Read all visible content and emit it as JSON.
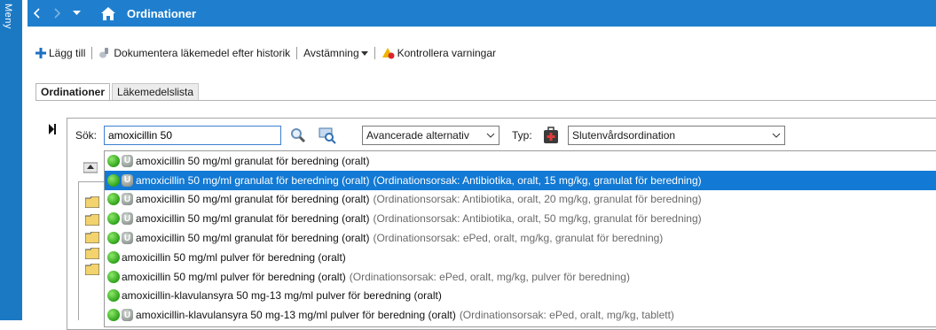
{
  "sidebar": {
    "menu_label": "Meny"
  },
  "titlebar": {
    "title": "Ordinationer",
    "icons": [
      "chevron-left-icon",
      "chevron-right-icon",
      "dropdown-triangle-icon",
      "home-icon"
    ]
  },
  "toolbar": {
    "add_label": "Lägg till",
    "document_label": "Dokumentera läkemedel efter historik",
    "reconcile_label": "Avstämning",
    "warnings_label": "Kontrollera varningar"
  },
  "tabs": [
    {
      "label": "Ordinationer",
      "active": true
    },
    {
      "label": "Läkemedelslista",
      "active": false
    }
  ],
  "search": {
    "label": "Sök:",
    "value": "amoxicillin 50",
    "advanced_value": "Avancerade alternativ",
    "type_label": "Typ:",
    "type_value": "Slutenvårdsordination"
  },
  "suggestions": [
    {
      "badge": true,
      "name": "amoxicillin 50 mg/ml granulat för beredning (oralt)",
      "reason": ""
    },
    {
      "badge": true,
      "name": "amoxicillin 50 mg/ml granulat för beredning (oralt)",
      "reason": "(Ordinationsorsak: Antibiotika, oralt, 15 mg/kg, granulat för beredning)",
      "selected": true
    },
    {
      "badge": true,
      "name": "amoxicillin 50 mg/ml granulat för beredning (oralt)",
      "reason": "(Ordinationsorsak: Antibiotika, oralt, 20 mg/kg, granulat för beredning)"
    },
    {
      "badge": true,
      "name": "amoxicillin 50 mg/ml granulat för beredning (oralt)",
      "reason": "(Ordinationsorsak: Antibiotika, oralt, 50 mg/kg, granulat för beredning)"
    },
    {
      "badge": true,
      "name": "amoxicillin 50 mg/ml granulat för beredning (oralt)",
      "reason": "(Ordinationsorsak: ePed, oralt, mg/kg, granulat för beredning)"
    },
    {
      "badge": false,
      "name": "amoxicillin 50 mg/ml pulver för beredning (oralt)",
      "reason": ""
    },
    {
      "badge": false,
      "name": "amoxicillin 50 mg/ml pulver för beredning (oralt)",
      "reason": "(Ordinationsorsak: ePed, oralt, mg/kg, pulver för beredning)"
    },
    {
      "badge": false,
      "name": "amoxicillin-klavulansyra 50 mg-13 mg/ml pulver för beredning (oralt)",
      "reason": ""
    },
    {
      "badge": true,
      "name": "amoxicillin-klavulansyra 50 mg-13 mg/ml pulver för beredning (oralt)",
      "reason": "(Ordinationsorsak: ePed, oralt, mg/kg, tablett)"
    }
  ],
  "colors": {
    "titlebar": "#1f7fce",
    "selection": "#1279d4",
    "status_green": "#2da21a"
  }
}
